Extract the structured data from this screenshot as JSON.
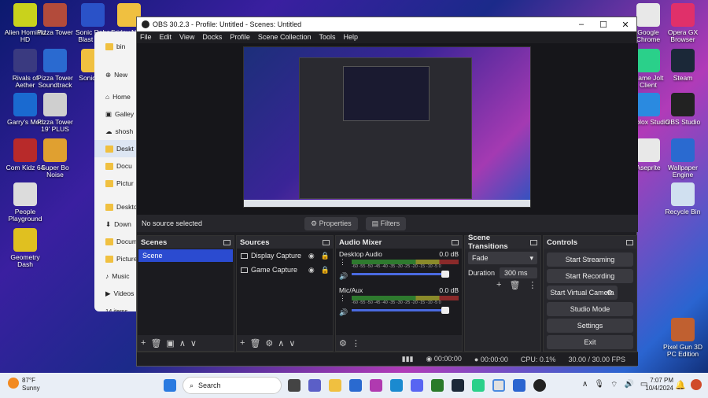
{
  "desktop_icons_left": [
    {
      "label": "Alien Hominid HD",
      "icon": "alien-icon",
      "color": "#c9d21c"
    },
    {
      "label": "Pizza Tower",
      "icon": "pizza-tower-icon",
      "color": "#b34b3b"
    },
    {
      "label": "Sonic Robo Blast 2 v2",
      "icon": "sonic-icon",
      "color": "#2a52c8"
    },
    {
      "label": "Friday Night",
      "icon": "folder-icon",
      "color": "#f0c040"
    },
    {
      "label": "bin",
      "icon": "bin-folder-icon",
      "color": "#f0c040"
    },
    {
      "label": "Rivals of Aether",
      "icon": "rivals-icon",
      "color": "#3a3a80"
    },
    {
      "label": "Pizza Tower Soundtrack",
      "icon": "music-icon",
      "color": "#2a6ad0"
    },
    {
      "label": "Sonic Ma",
      "icon": "sonic-mania-icon",
      "color": "#f0c040"
    },
    {
      "label": "Garry's Mod",
      "icon": "gmod-icon",
      "color": "#1a6ad0"
    },
    {
      "label": "Pizza Tower 19' PLUS",
      "icon": "pizza-plus-icon",
      "color": "#cfcfcf"
    },
    {
      "label": "Com Kidz 64",
      "icon": "comkidz-icon",
      "color": "#b82a2a"
    },
    {
      "label": "Super Bo Noise",
      "icon": "noise-icon",
      "color": "#e0a030"
    },
    {
      "label": "People Playground",
      "icon": "people-icon",
      "color": "#dcdcdc"
    },
    {
      "label": "Geometry Dash",
      "icon": "geometry-dash-icon",
      "color": "#e0c020"
    }
  ],
  "desktop_icons_right": [
    {
      "label": "Google Chrome",
      "icon": "chrome-icon",
      "color": "#e8e8e8"
    },
    {
      "label": "Opera GX Browser",
      "icon": "opera-icon",
      "color": "#e0306a"
    },
    {
      "label": "Game Jolt Client",
      "icon": "gamejolt-icon",
      "color": "#2ad08a"
    },
    {
      "label": "Steam",
      "icon": "steam-icon",
      "color": "#1b2838"
    },
    {
      "label": "Roblox Studio",
      "icon": "roblox-icon",
      "color": "#2a8ae0"
    },
    {
      "label": "OBS Studio",
      "icon": "obs-icon",
      "color": "#222222"
    },
    {
      "label": "Aseprite",
      "icon": "aseprite-icon",
      "color": "#e8e8e8"
    },
    {
      "label": "Wallpaper Engine",
      "icon": "wallpaper-engine-icon",
      "color": "#2a6ad0"
    },
    {
      "label": "Recycle Bin",
      "icon": "recycle-bin-icon",
      "color": "#d0e0f0"
    },
    {
      "label": "Pixel Gun 3D PC Edition",
      "icon": "pixel-gun-icon",
      "color": "#c06030"
    }
  ],
  "explorer": {
    "home": "Home",
    "gallery": "Galley",
    "shoshi": "shosh",
    "desktop": "Deskt",
    "documents": "Docu",
    "pictures": "Pictur",
    "desktop2": "Deskto",
    "downloads": "Down",
    "documents2": "Docum",
    "pictures2": "Picture",
    "music": "Music",
    "videos": "Videos",
    "new": "New",
    "count": "14 items"
  },
  "obs": {
    "title": "OBS 30.2.3 - Profile: Untitled - Scenes: Untitled",
    "menu": [
      "File",
      "Edit",
      "View",
      "Docks",
      "Profile",
      "Scene Collection",
      "Tools",
      "Help"
    ],
    "no_source": "No source selected",
    "properties": "Properties",
    "filters": "Filters",
    "scenes_title": "Scenes",
    "scenes": [
      "Scene"
    ],
    "sources_title": "Sources",
    "sources": [
      {
        "name": "Display Capture",
        "icon": "monitor-icon"
      },
      {
        "name": "Game Capture",
        "icon": "gamepad-icon"
      }
    ],
    "mixer_title": "Audio Mixer",
    "mixer": [
      {
        "name": "Desktop Audio",
        "db": "0.0 dB",
        "level": 1.0
      },
      {
        "name": "Mic/Aux",
        "db": "0.0 dB",
        "level": 1.0
      }
    ],
    "meter_ticks": "-60 -55 -50 -45 -40 -35 -30 -25 -20 -15 -10 -5 0",
    "transitions_title": "Scene Transitions",
    "transition": "Fade",
    "duration_label": "Duration",
    "duration": "300 ms",
    "controls_title": "Controls",
    "controls": [
      "Start Streaming",
      "Start Recording",
      "Start Virtual Camera",
      "Studio Mode",
      "Settings",
      "Exit"
    ],
    "status": {
      "stream_time": "00:00:00",
      "rec_time": "00:00:00",
      "cpu": "CPU: 0.1%",
      "fps": "30.00 / 30.00 FPS"
    }
  },
  "taskbar": {
    "temp": "87°F",
    "weather": "Sunny",
    "search_placeholder": "Search",
    "time": "7:07 PM",
    "date": "10/4/2024"
  }
}
